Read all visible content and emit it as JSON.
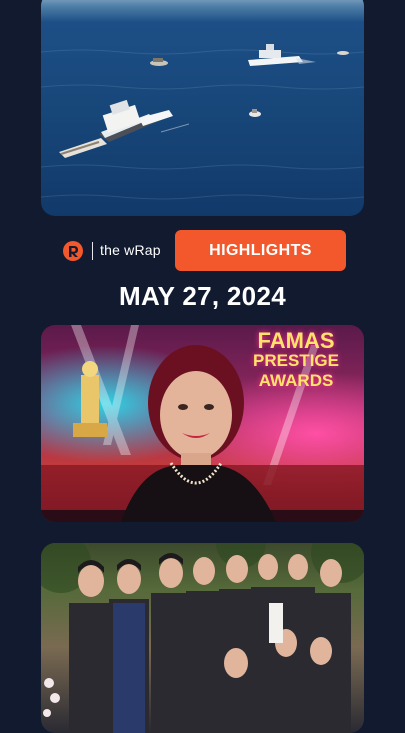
{
  "brand": {
    "name": "the wRap",
    "logo_icon": "rappler-logo-icon",
    "accent": "#f2582b"
  },
  "highlights_label": "HIGHLIGHTS",
  "date_title": "MAY 27, 2024",
  "awards_sign": {
    "line1": "FAMAS",
    "line2": "PRESTIGE",
    "line3": "AWARDS"
  },
  "colors": {
    "background": "#111a2e",
    "highlight_button": "#f2582b"
  }
}
